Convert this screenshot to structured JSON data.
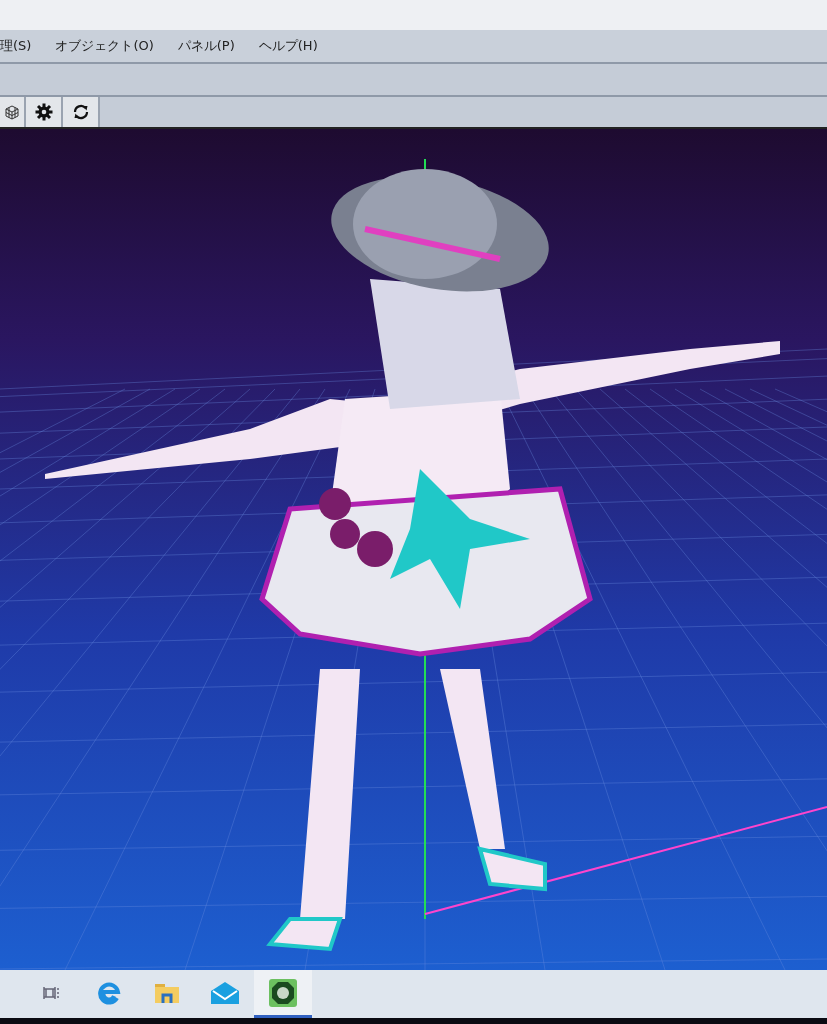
{
  "menu_bar": {
    "items": [
      {
        "label": "理(S)"
      },
      {
        "label": "オブジェクト(O)"
      },
      {
        "label": "パネル(P)"
      },
      {
        "label": "ヘルプ(H)"
      }
    ]
  },
  "taskbar": {
    "items": [
      {
        "kind": "taskview",
        "selected": false
      },
      {
        "kind": "browser",
        "selected": false
      },
      {
        "kind": "folder",
        "selected": false
      },
      {
        "kind": "mail",
        "selected": false
      },
      {
        "kind": "modeler",
        "selected": true
      }
    ]
  }
}
